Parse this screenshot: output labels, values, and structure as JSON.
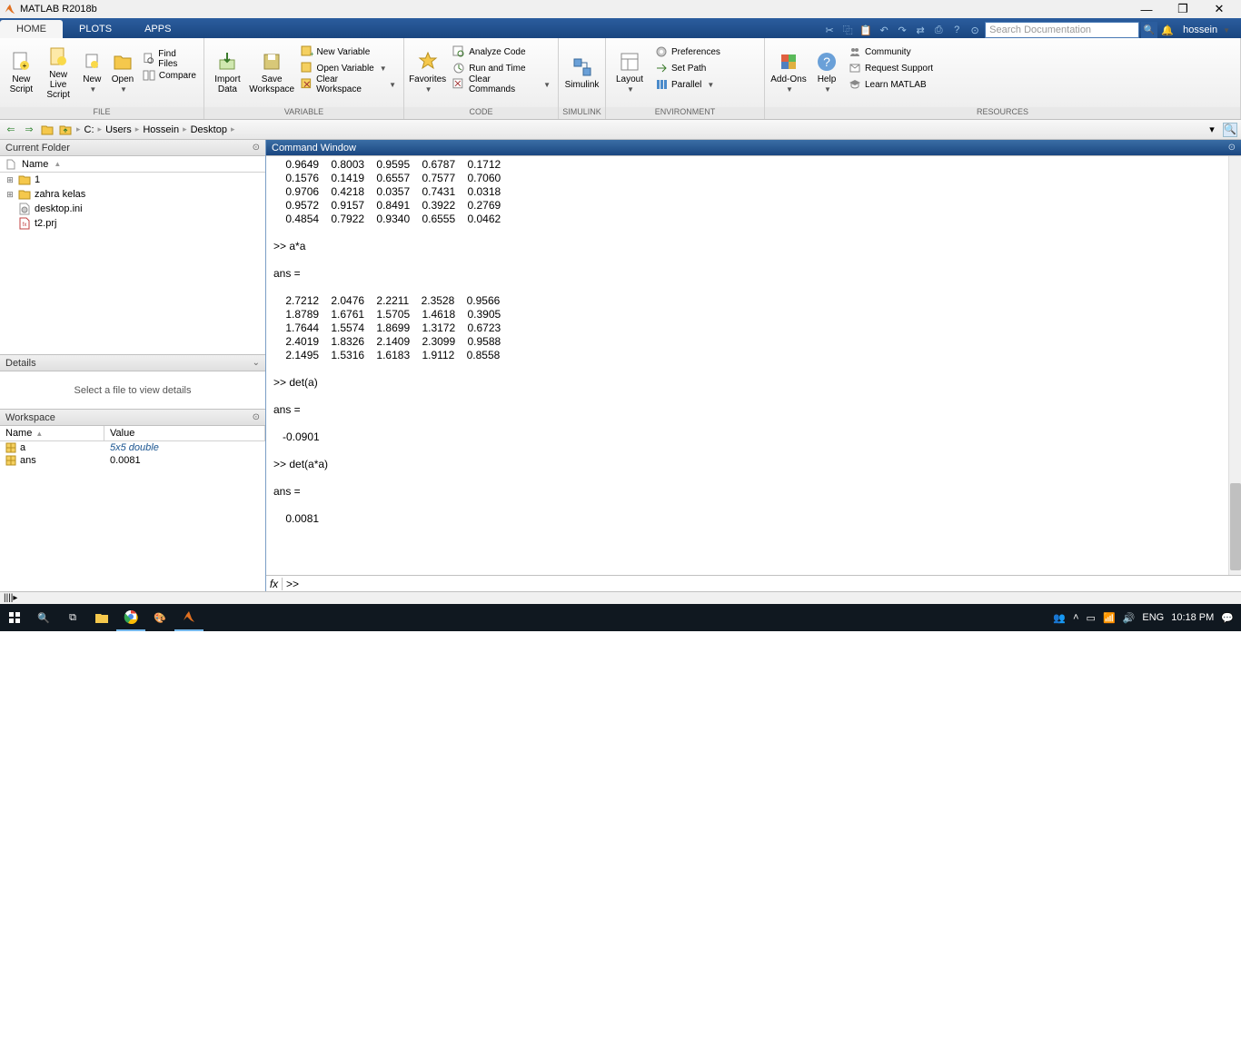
{
  "window": {
    "title": "MATLAB R2018b"
  },
  "tabs": {
    "home": "HOME",
    "plots": "PLOTS",
    "apps": "APPS"
  },
  "search": {
    "placeholder": "Search Documentation"
  },
  "user": {
    "name": "hossein"
  },
  "ribbon": {
    "file": {
      "label": "FILE",
      "new_script": "New\nScript",
      "new_live": "New\nLive Script",
      "new": "New",
      "open": "Open",
      "find_files": "Find Files",
      "compare": "Compare"
    },
    "variable": {
      "label": "VARIABLE",
      "import": "Import\nData",
      "save_ws": "Save\nWorkspace",
      "new_var": "New Variable",
      "open_var": "Open Variable",
      "clear_ws": "Clear Workspace"
    },
    "code": {
      "label": "CODE",
      "favorites": "Favorites",
      "analyze": "Analyze Code",
      "run_time": "Run and Time",
      "clear_cmd": "Clear Commands"
    },
    "simulink": {
      "label": "SIMULINK",
      "btn": "Simulink"
    },
    "environment": {
      "label": "ENVIRONMENT",
      "layout": "Layout",
      "prefs": "Preferences",
      "set_path": "Set Path",
      "parallel": "Parallel"
    },
    "addons": {
      "btn": "Add-Ons"
    },
    "resources": {
      "label": "RESOURCES",
      "help": "Help",
      "community": "Community",
      "support": "Request Support",
      "learn": "Learn MATLAB"
    }
  },
  "path": {
    "drive": "C:",
    "p1": "Users",
    "p2": "Hossein",
    "p3": "Desktop"
  },
  "current_folder": {
    "title": "Current Folder",
    "name_col": "Name",
    "items": [
      {
        "name": "1",
        "type": "folder",
        "exp": true
      },
      {
        "name": "zahra kelas",
        "type": "folder",
        "exp": true
      },
      {
        "name": "desktop.ini",
        "type": "file"
      },
      {
        "name": "t2.prj",
        "type": "prj"
      }
    ]
  },
  "details": {
    "title": "Details",
    "msg": "Select a file to view details"
  },
  "workspace": {
    "title": "Workspace",
    "cols": {
      "name": "Name",
      "value": "Value"
    },
    "rows": [
      {
        "name": "a",
        "value": "5x5 double",
        "italic": true
      },
      {
        "name": "ans",
        "value": "0.0081"
      }
    ]
  },
  "command": {
    "title": "Command Window",
    "output": "    0.9649    0.8003    0.9595    0.6787    0.1712\n    0.1576    0.1419    0.6557    0.7577    0.7060\n    0.9706    0.4218    0.0357    0.7431    0.0318\n    0.9572    0.9157    0.8491    0.3922    0.2769\n    0.4854    0.7922    0.9340    0.6555    0.0462\n\n>> a*a\n\nans =\n\n    2.7212    2.0476    2.2211    2.3528    0.9566\n    1.8789    1.6761    1.5705    1.4618    0.3905\n    1.7644    1.5574    1.8699    1.3172    0.6723\n    2.4019    1.8326    2.1409    2.3099    0.9588\n    2.1495    1.5316    1.6183    1.9112    0.8558\n\n>> det(a)\n\nans =\n\n   -0.0901\n\n>> det(a*a)\n\nans =\n\n    0.0081\n",
    "prompt": ">> "
  },
  "taskbar": {
    "lang": "ENG",
    "time": "10:18 PM"
  }
}
